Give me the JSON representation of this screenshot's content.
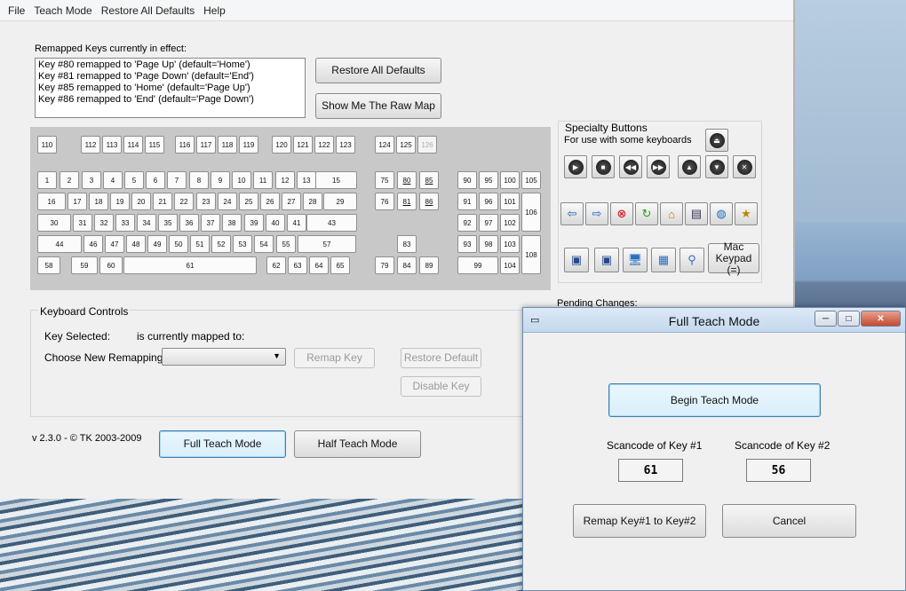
{
  "menu": [
    "File",
    "Teach Mode",
    "Restore All Defaults",
    "Help"
  ],
  "remapped_label": "Remapped Keys currently in effect:",
  "remapped": [
    "Key #80 remapped to 'Page Up' (default='Home')",
    "Key #81 remapped to 'Page Down' (default='End')",
    "Key #85 remapped to 'Home' (default='Page Up')",
    "Key #86 remapped to 'End' (default='Page Down')"
  ],
  "buttons": {
    "restore_all": "Restore All Defaults",
    "raw_map": "Show Me The Raw Map",
    "remap_key": "Remap Key",
    "restore_default": "Restore Default",
    "disable_key": "Disable Key",
    "full_teach": "Full Teach Mode",
    "half_teach": "Half Teach Mode",
    "mac_keypad": "Mac Keypad (=)"
  },
  "keys": {
    "row_f": [
      "110",
      "112",
      "113",
      "114",
      "115",
      "116",
      "117",
      "118",
      "119",
      "120",
      "121",
      "122",
      "123",
      "124",
      "125",
      "126"
    ],
    "row1": [
      "1",
      "2",
      "3",
      "4",
      "5",
      "6",
      "7",
      "8",
      "9",
      "10",
      "11",
      "12",
      "13",
      "15"
    ],
    "row2": [
      "16",
      "17",
      "18",
      "19",
      "20",
      "21",
      "22",
      "23",
      "24",
      "25",
      "26",
      "27",
      "28",
      "29"
    ],
    "row3": [
      "30",
      "31",
      "32",
      "33",
      "34",
      "35",
      "36",
      "37",
      "38",
      "39",
      "40",
      "41",
      "43"
    ],
    "row4": [
      "44",
      "46",
      "47",
      "48",
      "49",
      "50",
      "51",
      "52",
      "53",
      "54",
      "55",
      "57"
    ],
    "row5": [
      "58",
      "59",
      "60",
      "61",
      "62",
      "63",
      "64",
      "65"
    ],
    "nav": [
      "75",
      "80",
      "85",
      "76",
      "81",
      "86",
      "83",
      "79",
      "84",
      "89"
    ],
    "pad": [
      "90",
      "95",
      "100",
      "105",
      "91",
      "96",
      "101",
      "106",
      "92",
      "97",
      "102",
      "93",
      "98",
      "103",
      "108",
      "99",
      "104"
    ]
  },
  "specialty": {
    "title": "Specialty Buttons",
    "subtitle": "For use with some keyboards"
  },
  "controls": {
    "title": "Keyboard Controls",
    "key_selected": "Key Selected:",
    "mapped_to": "is currently mapped to:",
    "choose": "Choose New Remapping"
  },
  "version": "v 2.3.0 - © TK 2003-2009",
  "pending": "Pending Changes:",
  "dialog": {
    "title": "Full Teach Mode",
    "begin": "Begin Teach Mode",
    "sc1_label": "Scancode of Key #1",
    "sc2_label": "Scancode of Key #2",
    "sc1": "61",
    "sc2": "56",
    "remap": "Remap Key#1 to Key#2",
    "cancel": "Cancel"
  }
}
